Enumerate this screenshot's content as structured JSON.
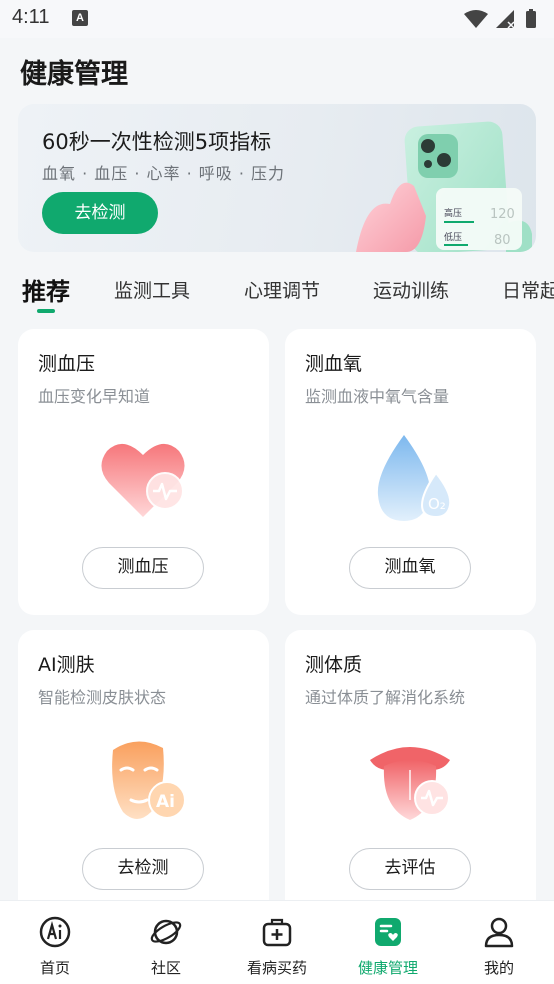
{
  "status_bar": {
    "time": "4:11",
    "notification_letter": "A"
  },
  "page_title": "健康管理",
  "banner": {
    "title": "60秒一次性检测5项指标",
    "subtitle": "血氧 · 血压 · 心率 · 呼吸 · 压力",
    "button_label": "去检测",
    "art_label_1": "高压",
    "art_value_1": "120",
    "art_label_2": "低压",
    "art_value_2": "80"
  },
  "tabs": [
    {
      "label": "推荐",
      "active": true
    },
    {
      "label": "监测工具",
      "active": false
    },
    {
      "label": "心理调节",
      "active": false
    },
    {
      "label": "运动训练",
      "active": false
    },
    {
      "label": "日常起",
      "active": false
    }
  ],
  "cards": [
    {
      "title": "测血压",
      "subtitle": "血压变化早知道",
      "button_label": "测血压",
      "icon": "heart-pulse-icon"
    },
    {
      "title": "测血氧",
      "subtitle": "监测血液中氧气含量",
      "button_label": "测血氧",
      "icon": "oxygen-drop-icon",
      "icon_text": "O₂"
    },
    {
      "title": "AI测肤",
      "subtitle": "智能检测皮肤状态",
      "button_label": "去检测",
      "icon": "face-mask-icon",
      "icon_text": "Ai"
    },
    {
      "title": "测体质",
      "subtitle": "通过体质了解消化系统",
      "button_label": "去评估",
      "icon": "tongue-icon"
    }
  ],
  "bottom_nav": [
    {
      "label": "首页",
      "icon": "ai-home-icon",
      "active": false
    },
    {
      "label": "社区",
      "icon": "planet-icon",
      "active": false
    },
    {
      "label": "看病买药",
      "icon": "medical-kit-icon",
      "active": false
    },
    {
      "label": "健康管理",
      "icon": "health-management-icon",
      "active": true
    },
    {
      "label": "我的",
      "icon": "person-icon",
      "active": false
    }
  ],
  "colors": {
    "accent": "#10a96e",
    "heart": "#f0575c",
    "drop": "#8fc3f2",
    "mask": "#f7a868"
  }
}
